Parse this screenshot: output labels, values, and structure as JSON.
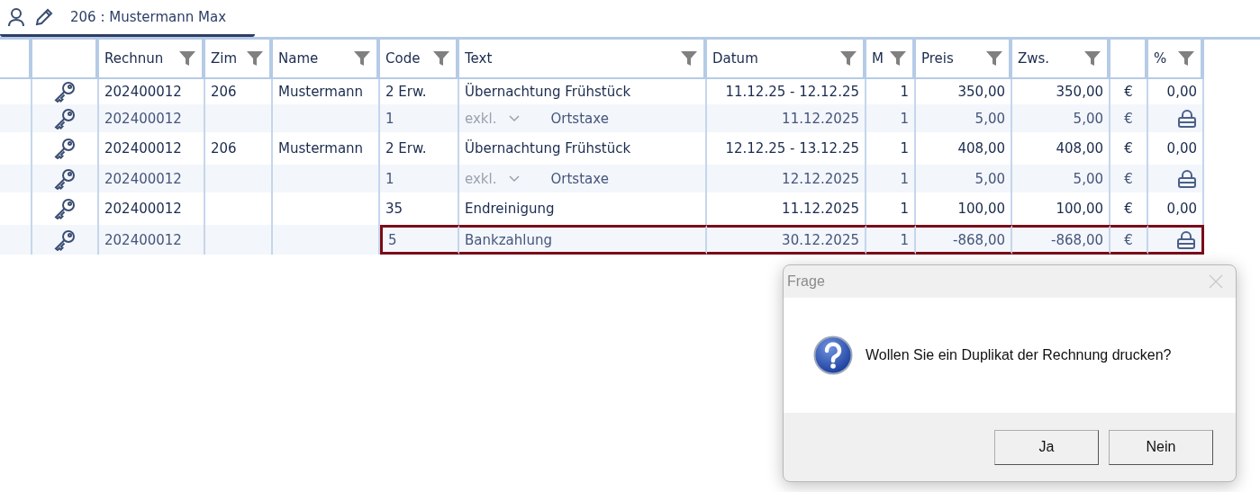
{
  "tab": {
    "label": "206 :  Mustermann Max",
    "selected": true
  },
  "columns": [
    {
      "filter": false
    },
    {
      "filter": false
    },
    {
      "label": "Rechnun",
      "filter": true
    },
    {
      "label": "Zim",
      "filter": true
    },
    {
      "label": "Name",
      "filter": true
    },
    {
      "label": "Code",
      "filter": true
    },
    {
      "label": "Text",
      "filter": true
    },
    {
      "label": "Datum",
      "filter": true
    },
    {
      "label": "M",
      "filter": true
    },
    {
      "label": "Preis",
      "filter": true
    },
    {
      "label": "Zws.",
      "filter": true
    },
    {
      "filter": false
    },
    {
      "label": "%",
      "filter": true
    }
  ],
  "rows": [
    {
      "kind": "main",
      "invoice": "202400012",
      "room": "206",
      "name": "Mustermann",
      "code": "2 Erw.",
      "text": "Übernachtung Frühstück",
      "date": "11.12.25 - 12.12.25",
      "qty": "1",
      "price": "350,00",
      "subtotal": "350,00",
      "currency": "€",
      "percent": "0,00",
      "locked": false,
      "highlighted": false
    },
    {
      "kind": "sub",
      "invoice": "202400012",
      "code": "1",
      "tax_mode": "exkl.",
      "text": "Ortstaxe",
      "date": "11.12.2025",
      "qty": "1",
      "price": "5,00",
      "subtotal": "5,00",
      "currency": "€",
      "locked": true,
      "highlighted": false
    },
    {
      "kind": "main",
      "invoice": "202400012",
      "room": "206",
      "name": "Mustermann",
      "code": "2 Erw.",
      "text": "Übernachtung Frühstück",
      "date": "12.12.25 - 13.12.25",
      "qty": "1",
      "price": "408,00",
      "subtotal": "408,00",
      "currency": "€",
      "percent": "0,00",
      "locked": false,
      "highlighted": false
    },
    {
      "kind": "sub",
      "invoice": "202400012",
      "code": "1",
      "tax_mode": "exkl.",
      "text": "Ortstaxe",
      "date": "12.12.2025",
      "qty": "1",
      "price": "5,00",
      "subtotal": "5,00",
      "currency": "€",
      "locked": true,
      "highlighted": false
    },
    {
      "kind": "main",
      "invoice": "202400012",
      "code": "35",
      "text": "Endreinigung",
      "date": "11.12.2025",
      "qty": "1",
      "price": "100,00",
      "subtotal": "100,00",
      "currency": "€",
      "percent": "0,00",
      "locked": false,
      "highlighted": false
    },
    {
      "kind": "sub",
      "invoice": "202400012",
      "code": "5",
      "text": "Bankzahlung",
      "date": "30.12.2025",
      "qty": "1",
      "price": "-868,00",
      "subtotal": "-868,00",
      "currency": "€",
      "locked": true,
      "highlighted": true
    }
  ],
  "dialog": {
    "title": "Frage",
    "message": "Wollen Sie ein Duplikat der Rechnung drucken?",
    "buttons": [
      "Ja",
      "Nein"
    ]
  }
}
